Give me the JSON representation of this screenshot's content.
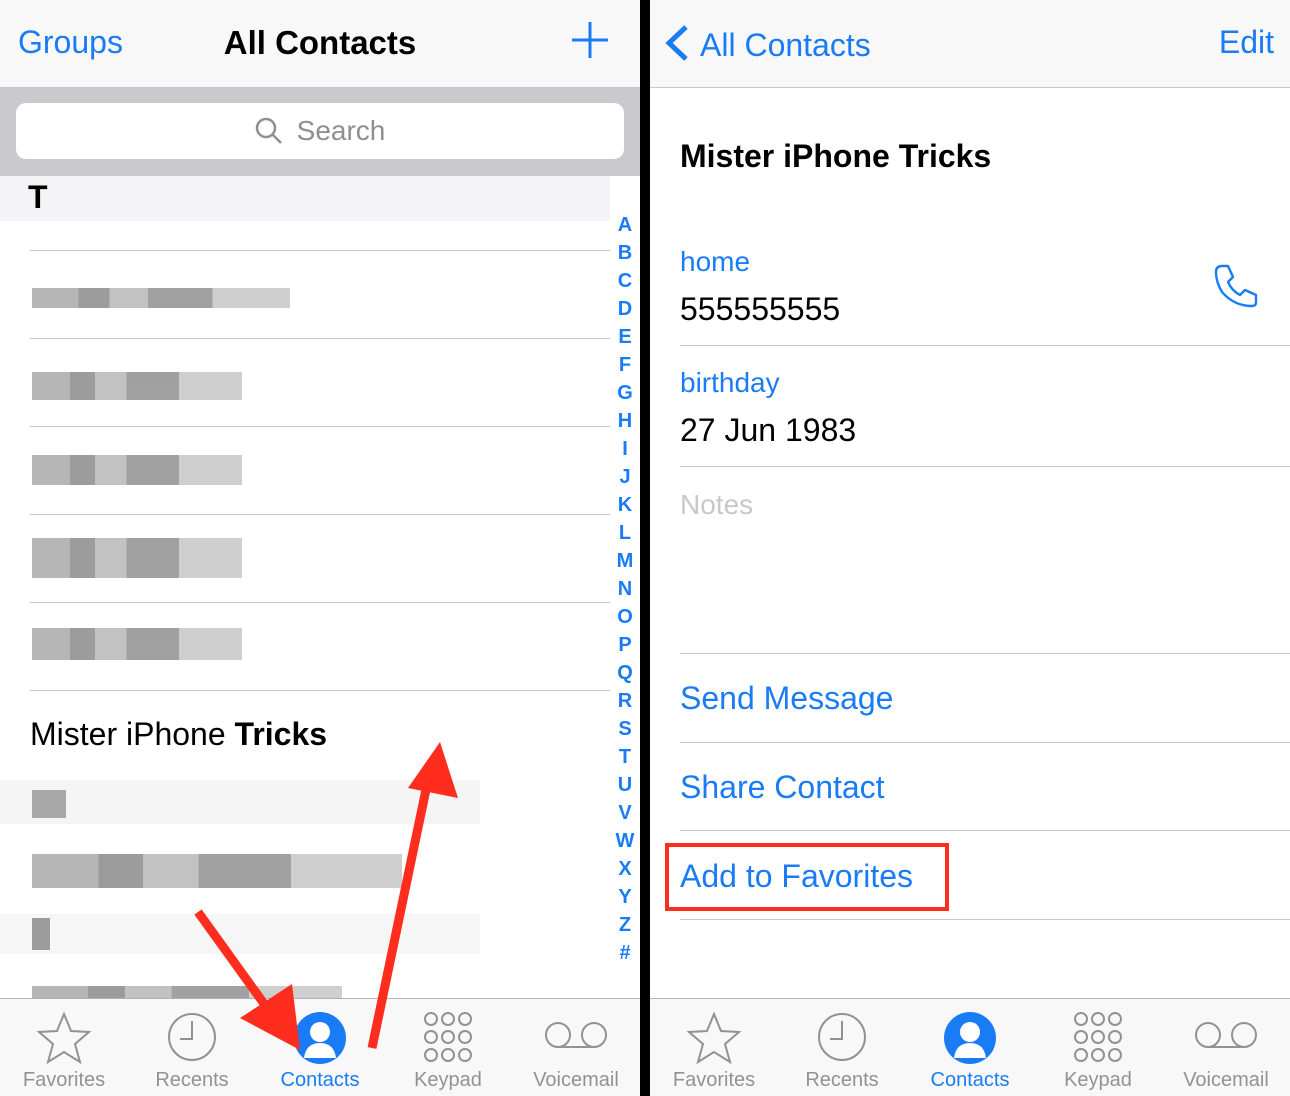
{
  "left": {
    "nav": {
      "groups": "Groups",
      "title": "All Contacts"
    },
    "search": {
      "placeholder": "Search"
    },
    "section": "T",
    "highlight": {
      "first": "Mister iPhone",
      "last": "Tricks"
    },
    "index": [
      "A",
      "B",
      "C",
      "D",
      "E",
      "F",
      "G",
      "H",
      "I",
      "J",
      "K",
      "L",
      "M",
      "N",
      "O",
      "P",
      "Q",
      "R",
      "S",
      "T",
      "U",
      "V",
      "W",
      "X",
      "Y",
      "Z",
      "#"
    ]
  },
  "right": {
    "nav": {
      "back": "All Contacts",
      "edit": "Edit"
    },
    "contact": {
      "name": "Mister iPhone Tricks",
      "phone_label": "home",
      "phone": "555555555",
      "birthday_label": "birthday",
      "birthday": "27 Jun 1983",
      "notes_placeholder": "Notes"
    },
    "actions": {
      "send_message": "Send Message",
      "share_contact": "Share Contact",
      "add_favorites": "Add to Favorites"
    }
  },
  "tabs": [
    "Favorites",
    "Recents",
    "Contacts",
    "Keypad",
    "Voicemail"
  ],
  "active_tab": "Contacts",
  "colors": {
    "accent": "#1a7cf5",
    "highlight": "#ff2d1e"
  }
}
